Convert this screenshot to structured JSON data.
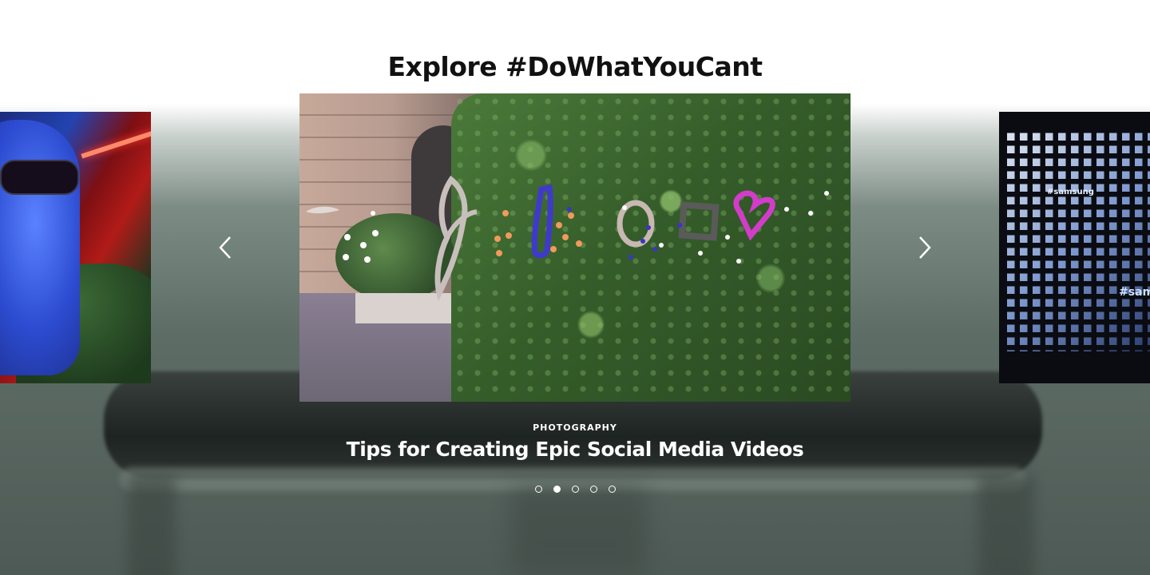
{
  "section": {
    "heading": "Explore #DoWhatYouCant"
  },
  "carousel": {
    "prev_label": "Previous",
    "next_label": "Next",
    "active_index": 1,
    "slide_count": 5,
    "current": {
      "category": "PHOTOGRAPHY",
      "title": "Tips for Creating Epic Social Media Videos"
    },
    "side_right_tag": "#sam",
    "side_right_tag_small": "#samsung"
  },
  "icons": {
    "prev": "chevron-left-icon",
    "next": "chevron-right-icon"
  },
  "colors": {
    "heading": "#111111",
    "caption": "#ffffff",
    "dot": "#ffffff"
  }
}
